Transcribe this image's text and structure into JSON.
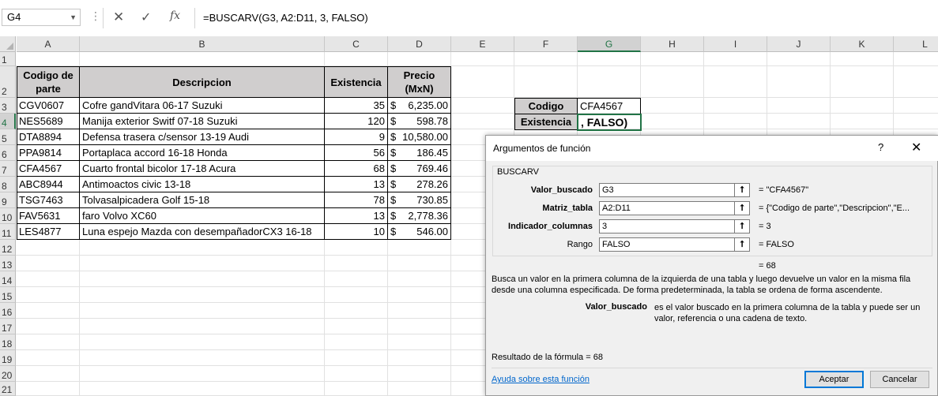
{
  "formula_bar": {
    "name_box": "G4",
    "cancel_icon": "close-icon",
    "enter_icon": "check-icon",
    "fx_label": "fx",
    "formula": "=BUSCARV(G3, A2:D11, 3, FALSO)"
  },
  "columns": [
    "A",
    "B",
    "C",
    "D",
    "E",
    "F",
    "G",
    "H",
    "I",
    "J",
    "K",
    "L"
  ],
  "rows": [
    "1",
    "2",
    "3",
    "4",
    "5",
    "6",
    "7",
    "8",
    "9",
    "10",
    "11",
    "12",
    "13",
    "14",
    "15",
    "16",
    "17",
    "18",
    "19",
    "20",
    "21"
  ],
  "table": {
    "headers": {
      "code": "Codigo de parte",
      "desc": "Descripcion",
      "stock": "Existencia",
      "price": "Precio (MxN)"
    },
    "rows": [
      {
        "code": "CGV0607",
        "desc": "Cofre gandVitara 06-17 Suzuki",
        "stock": "35",
        "cur": "$",
        "price": "6,235.00"
      },
      {
        "code": "NES5689",
        "desc": "Manija exterior Switf 07-18 Suzuki",
        "stock": "120",
        "cur": "$",
        "price": "598.78"
      },
      {
        "code": "DTA8894",
        "desc": "Defensa trasera c/sensor 13-19 Audi",
        "stock": "9",
        "cur": "$",
        "price": "10,580.00"
      },
      {
        "code": "PPA9814",
        "desc": "Portaplaca accord 16-18 Honda",
        "stock": "56",
        "cur": "$",
        "price": "186.45"
      },
      {
        "code": "CFA4567",
        "desc": "Cuarto frontal bicolor 17-18  Acura",
        "stock": "68",
        "cur": "$",
        "price": "769.46"
      },
      {
        "code": "ABC8944",
        "desc": "Antimoactos civic 13-18",
        "stock": "13",
        "cur": "$",
        "price": "278.26"
      },
      {
        "code": "TSG7463",
        "desc": "Tolvasalpicadera Golf 15-18",
        "stock": "78",
        "cur": "$",
        "price": "730.85"
      },
      {
        "code": "FAV5631",
        "desc": "faro Volvo XC60",
        "stock": "13",
        "cur": "$",
        "price": "2,778.36"
      },
      {
        "code": "LES4877",
        "desc": "Luna espejo Mazda con desempañadorCX3 16-18",
        "stock": "10",
        "cur": "$",
        "price": "546.00"
      }
    ]
  },
  "lookup": {
    "code_label": "Codigo",
    "code_value": "CFA4567",
    "stock_label": "Existencia",
    "stock_value": ", FALSO)"
  },
  "dialog": {
    "title": "Argumentos de función",
    "help": "?",
    "close": "✕",
    "function_name": "BUSCARV",
    "args": [
      {
        "label": "Valor_buscado",
        "value": "G3",
        "result": "=   \"CFA4567\""
      },
      {
        "label": "Matriz_tabla",
        "value": "A2:D11",
        "result": "=   {\"Codigo de parte\",\"Descripcion\",\"E..."
      },
      {
        "label": "Indicador_columnas",
        "value": "3",
        "result": "=   3"
      },
      {
        "label": "Rango",
        "value": "FALSO",
        "result": "=   FALSO"
      }
    ],
    "function_result": "=   68",
    "description": "Busca un valor en la primera columna de la izquierda de una tabla y luego devuelve un valor en la misma fila desde una columna especificada. De forma predeterminada, la tabla se ordena de forma ascendente.",
    "param_name": "Valor_buscado",
    "param_desc": "es el valor buscado en la primera columna de la tabla y puede ser un valor, referencia o una cadena de texto.",
    "formula_result": "Resultado de la fórmula =   68",
    "help_link": "Ayuda sobre esta función",
    "ok": "Aceptar",
    "cancel": "Cancelar"
  }
}
